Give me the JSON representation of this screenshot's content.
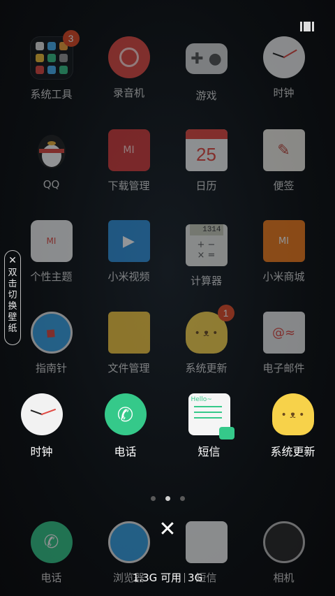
{
  "grid_apps": [
    {
      "label": "系统工具",
      "icon": "tools-folder-icon",
      "badge": "3"
    },
    {
      "label": "录音机",
      "icon": "recorder-icon",
      "badge": ""
    },
    {
      "label": "游戏",
      "icon": "gamepad-icon",
      "badge": ""
    },
    {
      "label": "时钟",
      "icon": "clock-icon",
      "badge": ""
    },
    {
      "label": "QQ",
      "icon": "qq-penguin-icon",
      "badge": ""
    },
    {
      "label": "下载管理",
      "icon": "download-box-icon",
      "badge": ""
    },
    {
      "label": "日历",
      "icon": "calendar-icon",
      "badge": "",
      "number": "25"
    },
    {
      "label": "便签",
      "icon": "notes-icon",
      "badge": ""
    },
    {
      "label": "个性主题",
      "icon": "theme-shirt-icon",
      "badge": ""
    },
    {
      "label": "小米视频",
      "icon": "video-clapper-icon",
      "badge": ""
    },
    {
      "label": "计算器",
      "icon": "calculator-icon",
      "badge": "",
      "display": "1314"
    },
    {
      "label": "小米商城",
      "icon": "shopping-bag-icon",
      "badge": ""
    },
    {
      "label": "指南针",
      "icon": "compass-icon",
      "badge": ""
    },
    {
      "label": "文件管理",
      "icon": "folder-icon",
      "badge": ""
    },
    {
      "label": "系统更新",
      "icon": "update-bear-icon",
      "badge": "1"
    },
    {
      "label": "电子邮件",
      "icon": "mail-icon",
      "badge": ""
    }
  ],
  "highlight_apps": [
    {
      "label": "时钟",
      "icon": "clock-icon"
    },
    {
      "label": "电话",
      "icon": "phone-icon"
    },
    {
      "label": "短信",
      "icon": "sms-icon"
    },
    {
      "label": "系统更新",
      "icon": "update-bear-icon"
    }
  ],
  "dock_apps": [
    {
      "label": "电话",
      "icon": "phone-icon"
    },
    {
      "label": "浏览器",
      "icon": "browser-icon"
    },
    {
      "label": "短信",
      "icon": "sms-icon"
    },
    {
      "label": "相机",
      "icon": "camera-icon"
    }
  ],
  "side_tab": {
    "close": "✕",
    "text": "双击切换壁纸"
  },
  "page_dots": {
    "count": 3,
    "active": 1
  },
  "close_button": "✕",
  "memory": {
    "available": "1.3G 可用",
    "total": "3G"
  },
  "colors": {
    "badge": "#e24a26",
    "phone": "#35c98a"
  }
}
